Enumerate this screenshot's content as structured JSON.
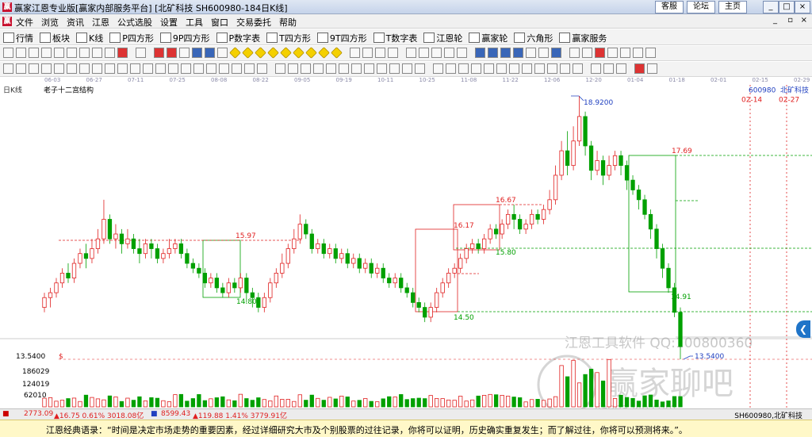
{
  "window": {
    "title": "赢家江恩专业版[赢家内部服务平台] [北矿科技  SH600980-184日K线]",
    "links": [
      "客服",
      "论坛",
      "主页"
    ]
  },
  "menu": [
    "文件",
    "浏览",
    "资讯",
    "江恩",
    "公式选股",
    "设置",
    "工具",
    "窗口",
    "交易委托",
    "帮助"
  ],
  "toolbar": [
    "行情",
    "板块",
    "K线",
    "P四方形",
    "9P四方形",
    "P数字表",
    "T四方形",
    "9T四方形",
    "T数字表",
    "江恩轮",
    "赢家轮",
    "六角形",
    "赢家服务"
  ],
  "chart": {
    "period_label": "日K线",
    "structure_label": "老子十二宫结构",
    "stock_code": "600980",
    "stock_name": "北矿科技",
    "marker_dates": [
      "02-14",
      "02-27"
    ],
    "price_labels": [
      "18.9200",
      "17.69",
      "16.67",
      "16.17",
      "15.97",
      "15.80",
      "14.80",
      "14.91",
      "14.50",
      "13.5400"
    ],
    "axis_labels": [
      "13.5400",
      "186029",
      "124019",
      "62010"
    ],
    "dollar_sign": "$",
    "watermark_text": "江恩工具软件  QQ:100800360",
    "forum_text": "赢家聊吧",
    "forum_url": "liaoba.vip.com"
  },
  "dates": [
    "06-03",
    "06-27",
    "07-11",
    "07-25",
    "08-08",
    "08-22",
    "09-05",
    "09-19",
    "10-11",
    "10-25",
    "11-08",
    "11-22",
    "12-06",
    "12-20",
    "01-04",
    "01-18",
    "02-01",
    "02-15",
    "02-29"
  ],
  "colors": {
    "up": "#e02020",
    "down": "#00a000",
    "box_green": "#00a000",
    "box_red": "#e02020",
    "blue": "#2040c0"
  },
  "chart_data": {
    "type": "candlestick",
    "high": 18.92,
    "low": 13.54,
    "candles": [
      [
        14.6,
        14.8,
        14.5,
        14.9
      ],
      [
        14.8,
        14.9,
        14.6,
        15.0
      ],
      [
        14.9,
        15.1,
        14.8,
        15.2
      ],
      [
        15.1,
        15.3,
        15.0,
        15.4
      ],
      [
        15.3,
        15.2,
        15.1,
        15.5
      ],
      [
        15.2,
        15.5,
        15.1,
        15.6
      ],
      [
        15.5,
        15.7,
        15.4,
        15.8
      ],
      [
        15.7,
        15.6,
        15.4,
        15.9
      ],
      [
        15.6,
        15.8,
        15.5,
        16.0
      ],
      [
        15.8,
        16.0,
        15.7,
        16.2
      ],
      [
        16.0,
        16.4,
        15.9,
        16.8
      ],
      [
        16.4,
        16.0,
        15.9,
        16.5
      ],
      [
        16.0,
        16.1,
        15.8,
        16.3
      ],
      [
        16.1,
        15.9,
        15.7,
        16.2
      ],
      [
        15.9,
        16.0,
        15.8,
        16.2
      ],
      [
        16.0,
        15.8,
        15.7,
        16.1
      ],
      [
        15.8,
        15.7,
        15.5,
        16.0
      ],
      [
        15.7,
        15.9,
        15.6,
        16.0
      ],
      [
        15.9,
        15.8,
        15.6,
        16.0
      ],
      [
        15.8,
        15.6,
        15.5,
        15.9
      ],
      [
        15.6,
        15.7,
        15.5,
        15.8
      ],
      [
        15.7,
        15.8,
        15.6,
        16.0
      ],
      [
        15.8,
        15.9,
        15.7,
        16.0
      ],
      [
        15.9,
        15.7,
        15.6,
        16.0
      ],
      [
        15.7,
        15.5,
        15.4,
        15.8
      ],
      [
        15.5,
        15.4,
        15.3,
        15.6
      ],
      [
        15.4,
        15.3,
        15.2,
        15.5
      ],
      [
        15.3,
        15.1,
        15.0,
        15.4
      ],
      [
        15.1,
        15.2,
        15.0,
        15.3
      ],
      [
        15.2,
        15.0,
        14.9,
        15.3
      ],
      [
        15.0,
        14.9,
        14.8,
        15.1
      ],
      [
        14.9,
        15.1,
        14.8,
        15.2
      ],
      [
        15.1,
        15.0,
        14.9,
        15.2
      ],
      [
        15.0,
        15.2,
        14.9,
        15.3
      ],
      [
        15.2,
        14.9,
        14.7,
        15.3
      ],
      [
        14.9,
        14.8,
        14.6,
        15.0
      ],
      [
        14.8,
        14.6,
        14.5,
        14.9
      ],
      [
        14.6,
        14.8,
        14.5,
        14.9
      ],
      [
        14.8,
        15.1,
        14.7,
        15.2
      ],
      [
        15.1,
        15.3,
        15.0,
        15.4
      ],
      [
        15.3,
        15.5,
        15.2,
        15.7
      ],
      [
        15.5,
        15.8,
        15.4,
        15.9
      ],
      [
        15.8,
        16.0,
        15.7,
        16.2
      ],
      [
        16.0,
        16.3,
        15.9,
        16.5
      ],
      [
        16.3,
        16.1,
        16.0,
        16.4
      ],
      [
        16.1,
        15.8,
        15.7,
        16.2
      ],
      [
        15.8,
        15.9,
        15.7,
        16.0
      ],
      [
        15.9,
        15.7,
        15.6,
        16.0
      ],
      [
        15.7,
        15.8,
        15.6,
        15.9
      ],
      [
        15.8,
        15.6,
        15.5,
        15.9
      ],
      [
        15.6,
        15.7,
        15.5,
        15.8
      ],
      [
        15.7,
        15.5,
        15.4,
        15.8
      ],
      [
        15.5,
        15.6,
        15.4,
        15.7
      ],
      [
        15.6,
        15.4,
        15.3,
        15.7
      ],
      [
        15.4,
        15.5,
        15.3,
        15.6
      ],
      [
        15.5,
        15.3,
        15.2,
        15.6
      ],
      [
        15.3,
        15.4,
        15.2,
        15.5
      ],
      [
        15.4,
        15.2,
        15.1,
        15.5
      ],
      [
        15.2,
        15.1,
        15.0,
        15.3
      ],
      [
        15.1,
        15.2,
        15.0,
        15.3
      ],
      [
        15.2,
        15.0,
        14.9,
        15.3
      ],
      [
        15.0,
        14.9,
        14.8,
        15.1
      ],
      [
        14.9,
        14.7,
        14.6,
        15.0
      ],
      [
        14.7,
        14.6,
        14.5,
        14.8
      ],
      [
        14.6,
        14.4,
        14.3,
        14.7
      ],
      [
        14.4,
        14.6,
        14.3,
        14.7
      ],
      [
        14.6,
        14.9,
        14.5,
        15.0
      ],
      [
        14.9,
        15.1,
        14.8,
        15.2
      ],
      [
        15.1,
        15.3,
        15.0,
        15.4
      ],
      [
        15.3,
        15.4,
        15.2,
        15.5
      ],
      [
        15.4,
        15.6,
        15.3,
        15.7
      ],
      [
        15.6,
        15.8,
        15.5,
        15.9
      ],
      [
        15.8,
        15.9,
        15.7,
        16.0
      ],
      [
        15.9,
        15.8,
        15.7,
        16.0
      ],
      [
        15.8,
        16.0,
        15.7,
        16.1
      ],
      [
        16.0,
        16.2,
        15.9,
        16.3
      ],
      [
        16.2,
        16.1,
        16.0,
        16.3
      ],
      [
        16.1,
        16.3,
        16.0,
        16.4
      ],
      [
        16.3,
        16.5,
        16.2,
        16.6
      ],
      [
        16.5,
        16.4,
        16.2,
        16.7
      ],
      [
        16.4,
        16.2,
        16.1,
        16.5
      ],
      [
        16.2,
        16.3,
        16.1,
        16.4
      ],
      [
        16.3,
        16.5,
        16.2,
        16.6
      ],
      [
        16.5,
        16.4,
        16.3,
        16.6
      ],
      [
        16.4,
        16.6,
        16.3,
        16.7
      ],
      [
        16.6,
        16.8,
        16.5,
        17.0
      ],
      [
        16.8,
        17.3,
        16.7,
        17.5
      ],
      [
        17.3,
        17.8,
        17.2,
        18.0
      ],
      [
        17.8,
        17.5,
        17.3,
        18.2
      ],
      [
        17.5,
        18.0,
        17.4,
        18.3
      ],
      [
        18.0,
        18.5,
        17.9,
        18.92
      ],
      [
        18.5,
        17.9,
        17.7,
        18.6
      ],
      [
        17.9,
        17.4,
        17.2,
        18.0
      ],
      [
        17.4,
        17.6,
        17.3,
        17.8
      ],
      [
        17.6,
        17.3,
        17.1,
        17.7
      ],
      [
        17.3,
        17.5,
        17.2,
        17.7
      ],
      [
        17.5,
        17.7,
        17.4,
        17.8
      ],
      [
        17.7,
        17.5,
        17.3,
        17.8
      ],
      [
        17.5,
        17.2,
        17.0,
        17.6
      ],
      [
        17.2,
        17.0,
        16.9,
        17.3
      ],
      [
        17.0,
        16.8,
        16.6,
        17.1
      ],
      [
        16.8,
        16.5,
        16.4,
        16.9
      ],
      [
        16.5,
        16.2,
        16.0,
        16.6
      ],
      [
        16.2,
        15.8,
        15.6,
        16.3
      ],
      [
        15.8,
        15.4,
        15.2,
        15.9
      ],
      [
        15.4,
        15.0,
        14.9,
        15.5
      ],
      [
        15.0,
        14.5,
        14.4,
        15.1
      ],
      [
        14.5,
        13.8,
        13.54,
        14.6
      ]
    ],
    "volume_ticks": [
      186029,
      124019,
      62010
    ]
  },
  "status": {
    "sh_index": "2773.09",
    "sh_change": "▲16.75 0.61% 3018.08亿",
    "sz_index": "8599.43",
    "sz_change": "▲119.88 1.41% 3779.91亿",
    "right": "SH600980,北矿科技"
  },
  "quote": "江恩经典语录：“时间是决定市场走势的重要因素，经过详细研究大市及个别股票的过往记录，你将可以证明，历史确实重复发生；而了解过往，你将可以预测将来。”。"
}
